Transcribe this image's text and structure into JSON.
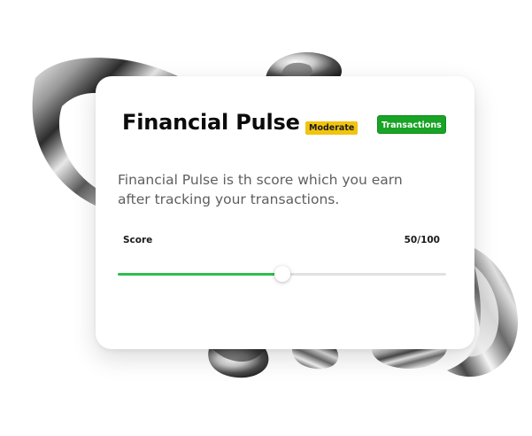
{
  "card": {
    "title": "Financial Pulse",
    "badge": "Moderate",
    "button_label": "Transactions",
    "description": "Financial Pulse is th score which you earn after tracking your transactions."
  },
  "score": {
    "label": "Score",
    "display": "50/100",
    "value": 50,
    "max": 100
  },
  "colors": {
    "badge_bg": "#f1c40f",
    "button_bg": "#18a426",
    "slider_fill": "#2ebd4e"
  },
  "icons": {
    "background": "chrome-swirl-decoration"
  }
}
